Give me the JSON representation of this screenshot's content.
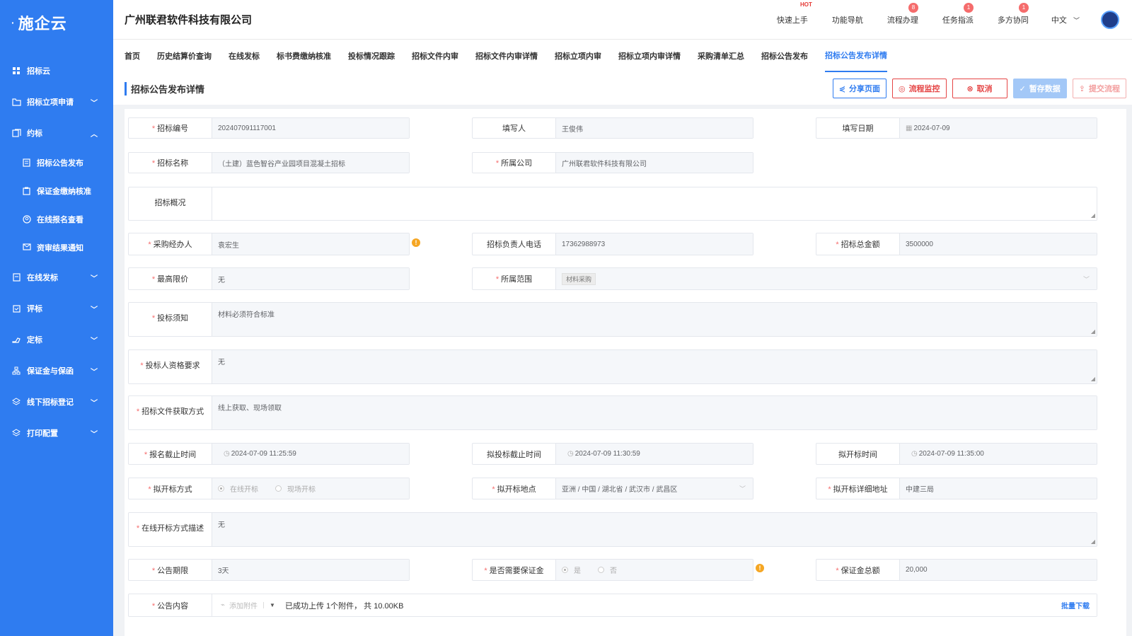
{
  "sidebar": {
    "logo": "施企云",
    "items": [
      {
        "label": "招标云",
        "icon": "grid-icon",
        "chev": ""
      },
      {
        "label": "招标立项申请",
        "icon": "folder-icon",
        "chev": "﹀"
      },
      {
        "label": "约标",
        "icon": "docs-icon",
        "chev": "︿"
      },
      {
        "label": "招标公告发布",
        "icon": "doc-icon"
      },
      {
        "label": "保证金缴纳核准",
        "icon": "clipboard-icon"
      },
      {
        "label": "在线报名查看",
        "icon": "user-circle-icon"
      },
      {
        "label": "资审结果通知",
        "icon": "mail-icon"
      },
      {
        "label": "在线发标",
        "icon": "file-icon",
        "chev": "﹀"
      },
      {
        "label": "评标",
        "icon": "check-clipboard-icon",
        "chev": "﹀"
      },
      {
        "label": "定标",
        "icon": "hand-icon",
        "chev": "﹀"
      },
      {
        "label": "保证金与保函",
        "icon": "org-icon",
        "chev": "﹀"
      },
      {
        "label": "线下招标登记",
        "icon": "layers-icon",
        "chev": "﹀"
      },
      {
        "label": "打印配置",
        "icon": "layers-icon",
        "chev": "﹀"
      }
    ]
  },
  "header": {
    "company": "广州联君软件科技有限公司",
    "quick_start": "快速上手",
    "hot": "HOT",
    "nav": "功能导航",
    "flow": "流程办理",
    "flow_badge": "8",
    "task": "任务指派",
    "task_badge": "1",
    "collab": "多方协同",
    "collab_badge": "1",
    "lang": "中文"
  },
  "tabs": [
    "首页",
    "历史结算价查询",
    "在线发标",
    "标书费缴纳核准",
    "投标情况跟踪",
    "招标文件内审",
    "招标文件内审详情",
    "招标立项内审",
    "招标立项内审详情",
    "采购清单汇总",
    "招标公告发布",
    "招标公告发布详情"
  ],
  "page": {
    "title": "招标公告发布详情",
    "btn_share": "分享页面",
    "btn_monitor": "流程监控",
    "btn_cancel": "取消",
    "btn_save": "暂存数据",
    "btn_submit": "提交流程"
  },
  "form": {
    "bid_no_label": "招标编号",
    "bid_no": "202407091117001",
    "writer_label": "填写人",
    "writer": "王俊伟",
    "date_label": "填写日期",
    "date": "2024-07-09",
    "bid_name_label": "招标名称",
    "bid_name": "（土建）蓝色智谷产业园项目混凝土招标",
    "company_label": "所属公司",
    "company": "广州联君软件科技有限公司",
    "overview_label": "招标概况",
    "overview": "",
    "agent_label": "采购经办人",
    "agent": "袁宏生",
    "phone_label": "招标负责人电话",
    "phone": "17362988973",
    "total_label": "招标总金额",
    "total": "3500000",
    "max_label": "最高限价",
    "max": "无",
    "scope_label": "所属范围",
    "scope": "材料采购",
    "notice_label": "投标须知",
    "notice": "材料必须符合标准",
    "qual_label": "投标人资格要求",
    "qual": "无",
    "obtain_label": "招标文件获取方式",
    "obtain": "线上获取、现场领取",
    "reg_end_label": "报名截止时间",
    "reg_end": "2024-07-09 11:25:59",
    "bid_end_label": "拟投标截止时间",
    "bid_end": "2024-07-09 11:30:59",
    "open_time_label": "拟开标时间",
    "open_time": "2024-07-09 11:35:00",
    "open_mode_label": "拟开标方式",
    "open_online": "在线开标",
    "open_onsite": "现场开标",
    "open_place_label": "拟开标地点",
    "open_place": "亚洲 / 中国 / 湖北省 / 武汉市 / 武昌区",
    "open_addr_label": "拟开标详细地址",
    "open_addr": "中建三局",
    "online_desc_label": "在线开标方式描述",
    "online_desc": "无",
    "period_label": "公告期限",
    "period": "3天",
    "deposit_need_label": "是否需要保证金",
    "yes": "是",
    "no": "否",
    "deposit_total_label": "保证金总额",
    "deposit_total": "20,000",
    "content_label": "公告内容",
    "attach": "添加附件",
    "upload_info": "已成功上传 1个附件， 共 10.00KB",
    "batch_download": "批量下载"
  }
}
